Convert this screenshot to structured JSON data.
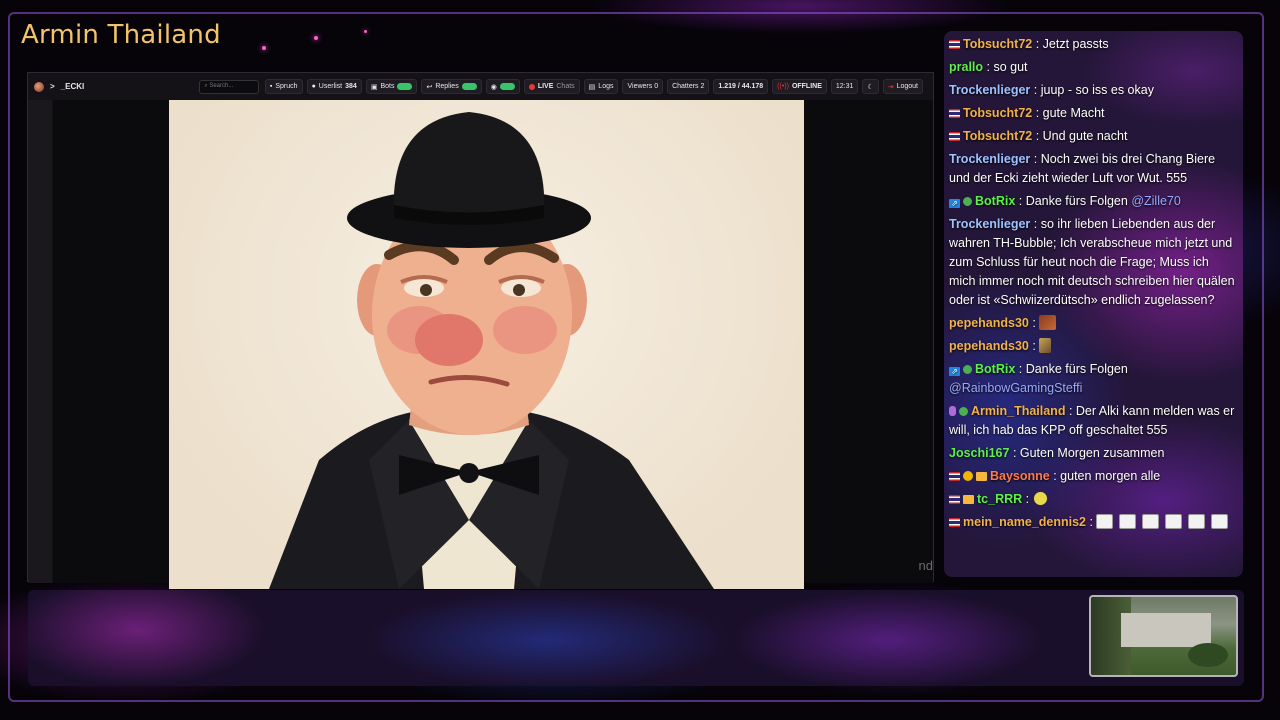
{
  "stream": {
    "title": "Armin Thailand"
  },
  "player": {
    "channel": "_ECKI",
    "search_placeholder": "Search...",
    "buttons": {
      "spruch": "Spruch",
      "userlist": "Userlist",
      "userlist_count": "384",
      "bots": "Bots",
      "replies": "Replies",
      "live": "LIVE",
      "chats": "Chats",
      "logs": "Logs",
      "viewers": "Viewers 0",
      "chatters": "Chatters 2",
      "ratio": "1.219 / 44.178",
      "offline": "OFFLINE",
      "time": "12:31",
      "logout": "Logout"
    },
    "video_tail_text": "nd"
  },
  "chat": {
    "messages": [
      {
        "badges": [
          "flag-th"
        ],
        "user": "Tobsucht72",
        "color": "#f2b14a",
        "text": ": Jetzt passts"
      },
      {
        "badges": [],
        "user": "prallo",
        "color": "#5ef04a",
        "text": ": so gut"
      },
      {
        "badges": [],
        "user": "Trockenlieger",
        "color": "#9ec2ff",
        "text": ": juup - so iss es okay"
      },
      {
        "badges": [
          "flag-th"
        ],
        "user": "Tobsucht72",
        "color": "#f2b14a",
        "text": ": gute Macht"
      },
      {
        "badges": [
          "flag-th"
        ],
        "user": "Tobsucht72",
        "color": "#f2b14a",
        "text": ": Und gute nacht"
      },
      {
        "badges": [],
        "user": "Trockenlieger",
        "color": "#9ec2ff",
        "text": ": Noch zwei bis drei Chang Biere und der Ecki zieht wieder Luft vor Wut. 555"
      },
      {
        "badges": [
          "bot",
          "ok"
        ],
        "user": "BotRix",
        "color": "#5ef04a",
        "text": ": Danke fürs Folgen ",
        "mention": "@Zille70"
      },
      {
        "badges": [],
        "user": "Trockenlieger",
        "color": "#9ec2ff",
        "text": ": so ihr lieben Liebenden aus der wahren TH-Bubble; Ich verabscheue mich jetzt und zum Schluss für heut noch die Frage; Muss ich mich immer noch mit deutsch schreiben hier quälen oder ist «Schwiizerdütsch» endlich zugelassen?"
      },
      {
        "badges": [],
        "user": "pepehands30",
        "color": "#f2b14a",
        "text": ":",
        "emote": "e1"
      },
      {
        "badges": [],
        "user": "pepehands30",
        "color": "#f2b14a",
        "text": ":",
        "emote": "e2"
      },
      {
        "badges": [
          "bot",
          "ok"
        ],
        "user": "BotRix",
        "color": "#5ef04a",
        "text": ": Danke fürs Folgen ",
        "mention": "@RainbowGamingSteffi"
      },
      {
        "badges": [
          "mic",
          "ok"
        ],
        "user": "Armin_Thailand",
        "color": "#f2b14a",
        "text": ": Der Alki kann melden was er will, ich hab das KPP off geschaltet 555"
      },
      {
        "badges": [],
        "user": "Joschi167",
        "color": "#5ef04a",
        "text": ": Guten Morgen zusammen"
      },
      {
        "badges": [
          "flag-th",
          "warn",
          "crown"
        ],
        "user": "Baysonne",
        "color": "#ff7a4a",
        "text": ": guten morgen alle"
      },
      {
        "badges": [
          "flag-th",
          "crown"
        ],
        "user": "tc_RRR",
        "color": "#5ef04a",
        "text": ":",
        "emote": "e3"
      },
      {
        "badges": [
          "flag-th"
        ],
        "user": "mein_name_dennis2",
        "color": "#f2b14a",
        "text": ":",
        "emote_repeat": 6
      }
    ]
  },
  "colors": {
    "title_gold": "#f2c46a",
    "chat_bg": "#241638",
    "accent_purple": "#9a5ae0"
  }
}
